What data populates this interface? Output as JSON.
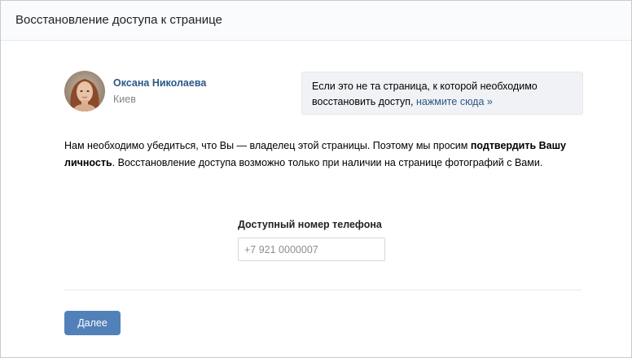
{
  "header": {
    "title": "Восстановление доступа к странице"
  },
  "profile": {
    "name": "Оксана Николаева",
    "city": "Киев"
  },
  "notice": {
    "text": "Если это не та страница, к которой необходимо восстановить доступ, ",
    "link": "нажмите сюда »"
  },
  "intro": {
    "part1": "Нам необходимо убедиться, что Вы — владелец этой страницы. Поэтому мы просим ",
    "bold": "подтвердить Вашу личность",
    "part2": ". Восстановление доступа возможно только при наличии на странице фотографий с Вами."
  },
  "phone": {
    "label": "Доступный номер телефона",
    "placeholder": "+7 921 0000007",
    "value": ""
  },
  "actions": {
    "next_label": "Далее"
  },
  "colors": {
    "link": "#2a5885",
    "button": "#5181b8",
    "header_bg": "#fafbfc",
    "notice_bg": "#f0f2f5"
  }
}
